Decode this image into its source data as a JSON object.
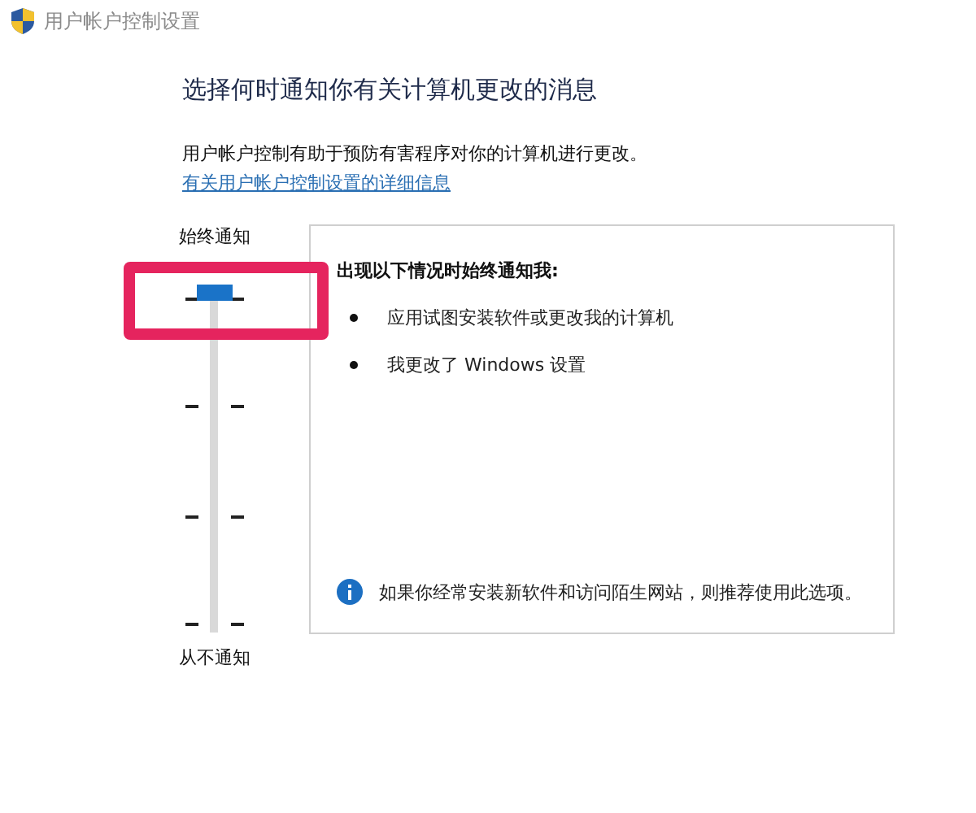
{
  "window": {
    "title": "用户帐户控制设置"
  },
  "heading": "选择何时通知你有关计算机更改的消息",
  "description": "用户帐户控制有助于预防有害程序对你的计算机进行更改。",
  "link": "有关用户帐户控制设置的详细信息",
  "slider": {
    "top_label": "始终通知",
    "bottom_label": "从不通知",
    "level": 1,
    "highlighted": true
  },
  "panel": {
    "title": "出现以下情况时始终通知我:",
    "bullets": [
      "应用试图安装软件或更改我的计算机",
      "我更改了 Windows 设置"
    ],
    "note": "如果你经常安装新软件和访问陌生网站，则推荐使用此选项。"
  }
}
